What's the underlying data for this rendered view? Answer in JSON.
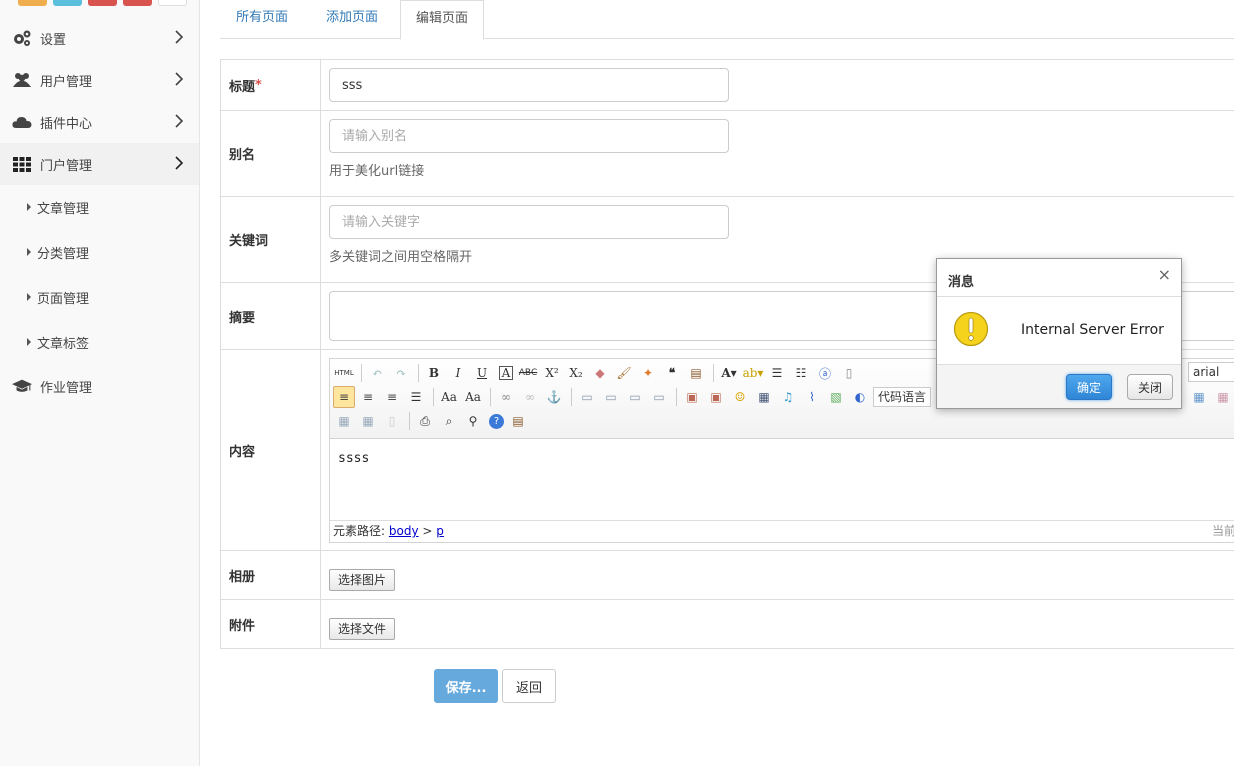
{
  "sidebar": {
    "shortcut_colors": [
      "#f0ad4e",
      "#5bc0de",
      "#d9534f",
      "#d9534f"
    ],
    "menu": [
      {
        "label": "设置",
        "icon": "gears-icon"
      },
      {
        "label": "用户管理",
        "icon": "users-icon"
      },
      {
        "label": "插件中心",
        "icon": "cloud-icon"
      },
      {
        "label": "门户管理",
        "icon": "grid-icon",
        "active": true
      },
      {
        "label": "作业管理",
        "icon": "graduation-cap-icon"
      }
    ],
    "submenu": [
      {
        "label": "文章管理"
      },
      {
        "label": "分类管理"
      },
      {
        "label": "页面管理"
      },
      {
        "label": "文章标签"
      }
    ]
  },
  "tabs": [
    {
      "label": "所有页面"
    },
    {
      "label": "添加页面"
    },
    {
      "label": "编辑页面",
      "active": true
    }
  ],
  "form": {
    "title": {
      "label": "标题",
      "required_mark": "*",
      "value": "sss"
    },
    "alias": {
      "label": "别名",
      "placeholder": "请输入别名",
      "help": "用于美化url链接"
    },
    "keywords": {
      "label": "关键词",
      "placeholder": "请输入关键字",
      "help": "多关键词之间用空格隔开"
    },
    "summary": {
      "label": "摘要"
    },
    "content": {
      "label": "内容",
      "body_text": "ssss",
      "status_prefix": "元素路径:",
      "path_body": "body",
      "path_sep": ">",
      "path_p": "p",
      "status_right": "当前已",
      "font_combo": "arial",
      "code_combo": "代码语言"
    },
    "album": {
      "label": "相册",
      "button": "选择图片"
    },
    "attachment": {
      "label": "附件",
      "button": "选择文件"
    }
  },
  "actions": {
    "save": "保存...",
    "back": "返回"
  },
  "dialog": {
    "title": "消息",
    "close": "×",
    "message": "Internal Server Error",
    "ok": "确定",
    "cancel": "关闭"
  },
  "colors": {
    "link": "#337ab7",
    "primary": "#66a9dd",
    "warning": "#f5d21c"
  }
}
